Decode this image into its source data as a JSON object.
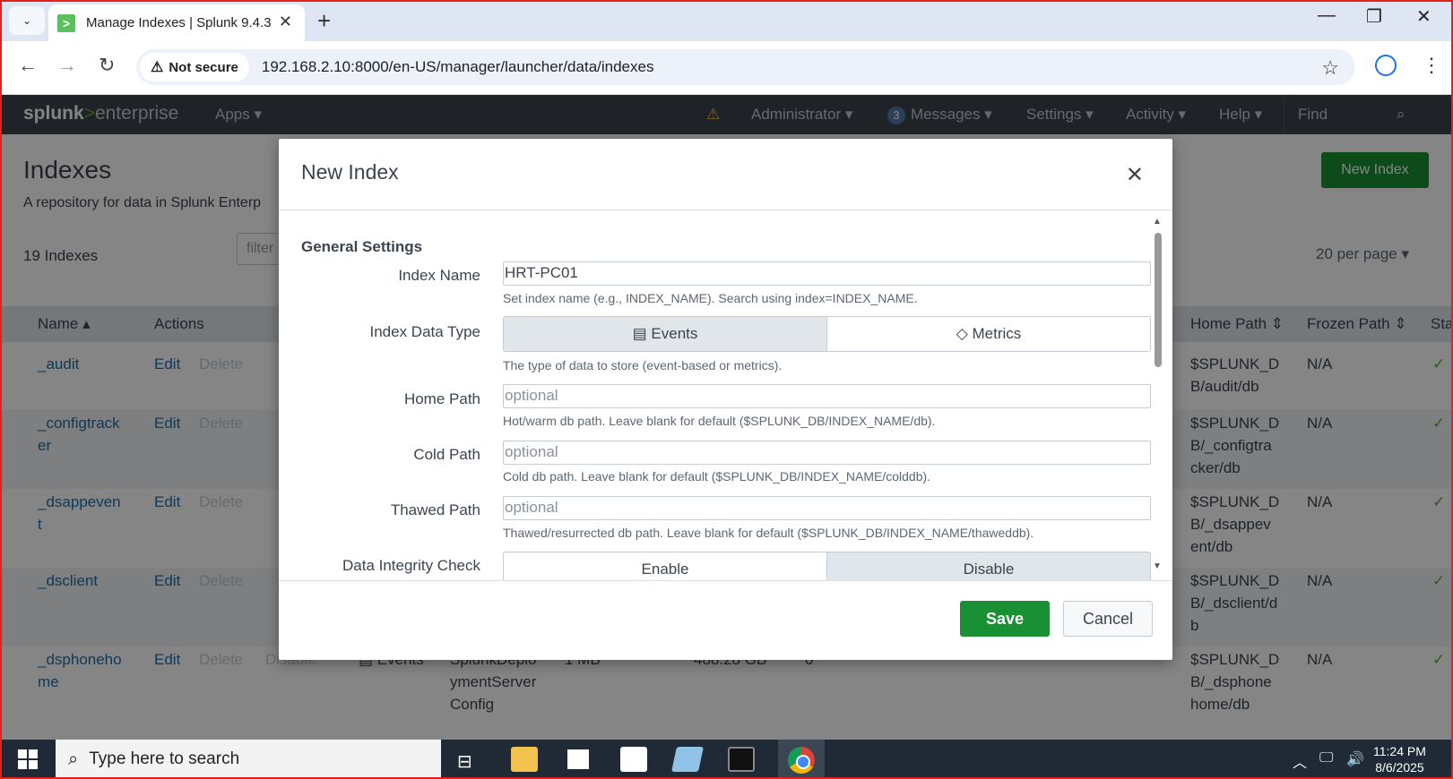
{
  "browser": {
    "tab_title": "Manage Indexes | Splunk 9.4.3",
    "tab_close": "✕",
    "new_tab": "+",
    "security_label": "Not secure",
    "url": "192.168.2.10:8000/en-US/manager/launcher/data/indexes",
    "window_controls": {
      "minimize": "—",
      "restore": "❐",
      "close": "✕"
    }
  },
  "splunk_nav": {
    "logo_brand": "splunk",
    "logo_arrow": ">",
    "logo_product": "enterprise",
    "apps": "Apps ▾",
    "administrator": "Administrator ▾",
    "messages_count": "3",
    "messages": "Messages ▾",
    "settings": "Settings ▾",
    "activity": "Activity ▾",
    "help": "Help ▾",
    "find": "Find"
  },
  "page": {
    "title": "Indexes",
    "subtitle": "A repository for data in Splunk Enterp",
    "new_index_button": "New Index",
    "count": "19 Indexes",
    "filter_placeholder": "filter",
    "per_page": "20 per page ▾"
  },
  "table": {
    "headers": {
      "name": "Name ▴",
      "actions": "Actions",
      "home_path": "Home Path ⇕",
      "frozen_path": "Frozen Path ⇕",
      "status": "Sta"
    },
    "rows": [
      {
        "name": "_audit",
        "name2": "",
        "home_path": "$SPLUNK_D",
        "home_path2": "B/audit/db",
        "home_path3": "",
        "frozen": "N/A"
      },
      {
        "name": "_configtrack",
        "name2": "er",
        "home_path": "$SPLUNK_D",
        "home_path2": "B/_configtra",
        "home_path3": "cker/db",
        "frozen": "N/A"
      },
      {
        "name": "_dsappeven",
        "name2": "t",
        "home_path": "$SPLUNK_D",
        "home_path2": "B/_dsappev",
        "home_path3": "ent/db",
        "frozen": "N/A"
      },
      {
        "name": "_dsclient",
        "name2": "",
        "home_path": "$SPLUNK_D",
        "home_path2": "B/_dsclient/d",
        "home_path3": "b",
        "frozen": "N/A"
      },
      {
        "name": "_dsphoneho",
        "name2": "me",
        "home_path": "$SPLUNK_D",
        "home_path2": "B/_dsphone",
        "home_path3": "home/db",
        "frozen": "N/A"
      }
    ],
    "action_edit": "Edit",
    "action_delete": "Delete",
    "action_disable": "Disable",
    "last_row": {
      "type": "Events",
      "app1": "SplunkDeplo",
      "app2": "ymentServer",
      "app3": "Config",
      "size": "1 MB",
      "max_size": "488.28 GB",
      "events": "0"
    },
    "status_check": "✓"
  },
  "modal": {
    "title": "New Index",
    "close": "✕",
    "section": "General Settings",
    "fields": {
      "index_name_label": "Index Name",
      "index_name_value": "HRT-PC01",
      "index_name_help": "Set index name (e.g., INDEX_NAME). Search using index=INDEX_NAME.",
      "data_type_label": "Index Data Type",
      "data_type_events": "Events",
      "data_type_metrics": "Metrics",
      "data_type_help": "The type of data to store (event-based or metrics).",
      "home_path_label": "Home Path",
      "home_path_placeholder": "optional",
      "home_path_help": "Hot/warm db path. Leave blank for default ($SPLUNK_DB/INDEX_NAME/db).",
      "cold_path_label": "Cold Path",
      "cold_path_placeholder": "optional",
      "cold_path_help": "Cold db path. Leave blank for default ($SPLUNK_DB/INDEX_NAME/colddb).",
      "thawed_path_label": "Thawed Path",
      "thawed_path_placeholder": "optional",
      "thawed_path_help": "Thawed/resurrected db path. Leave blank for default ($SPLUNK_DB/INDEX_NAME/thaweddb).",
      "integrity_label": "Data Integrity Check",
      "integrity_enable": "Enable",
      "integrity_disable": "Disable"
    },
    "save": "Save",
    "cancel": "Cancel"
  },
  "taskbar": {
    "search_placeholder": "Type here to search",
    "time": "11:24 PM",
    "date": "8/6/2025"
  },
  "colors": {
    "splunk_nav_bg": "#3c444d",
    "primary_green": "#1a9035",
    "link_blue": "#1e6ea8",
    "browser_frame": "#e2231a"
  }
}
